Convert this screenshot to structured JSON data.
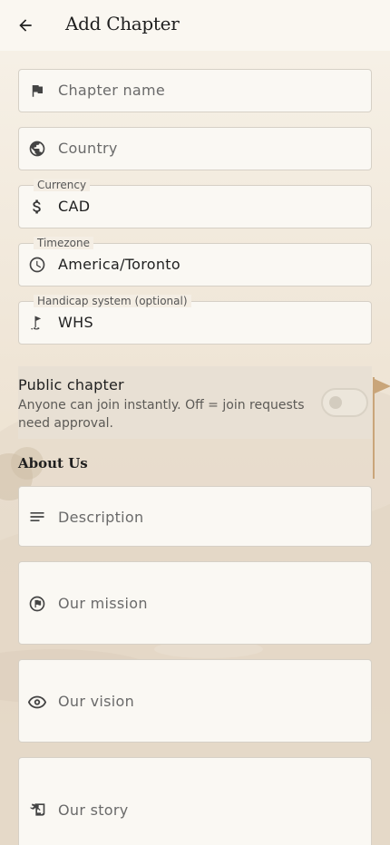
{
  "header": {
    "title": "Add Chapter"
  },
  "form": {
    "chapter_name": {
      "placeholder": "Chapter name",
      "icon": "flag-icon"
    },
    "country": {
      "placeholder": "Country",
      "icon": "globe-icon"
    },
    "currency": {
      "label": "Currency",
      "value": "CAD",
      "icon": "dollar-icon"
    },
    "timezone": {
      "label": "Timezone",
      "value": "America/Toronto",
      "icon": "clock-icon"
    },
    "handicap": {
      "label": "Handicap system (optional)",
      "value": "WHS",
      "icon": "golf-icon"
    }
  },
  "public_chapter": {
    "title": "Public chapter",
    "subtitle": "Anyone can join instantly. Off = join requests need approval.",
    "enabled": false
  },
  "about": {
    "section_title": "About Us",
    "description": {
      "placeholder": "Description",
      "icon": "notes-icon"
    },
    "mission": {
      "placeholder": "Our mission",
      "icon": "mission-flag-icon"
    },
    "vision": {
      "placeholder": "Our vision",
      "icon": "eye-icon"
    },
    "story": {
      "placeholder": "Our story",
      "icon": "history-edu-icon"
    }
  },
  "colors": {
    "background": "#f4ede2",
    "field_bg": "#faf8f3",
    "border": "#d6d0c6",
    "accent": "#c9a57a"
  }
}
